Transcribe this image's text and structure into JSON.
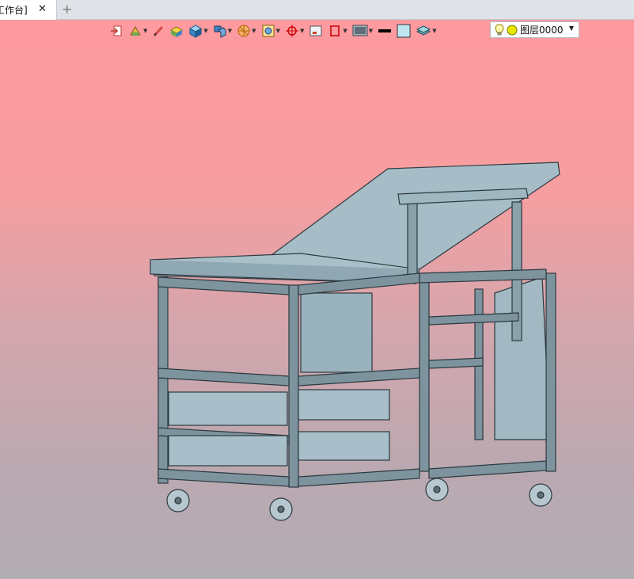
{
  "tabs": [
    {
      "label": "工作台]",
      "active": true
    }
  ],
  "tab_close_symbol": "✕",
  "tab_add_symbol": "+",
  "toolbar": {
    "icons": [
      "exit-sketch-icon",
      "component-icon",
      "pen-icon",
      "extrude-icon",
      "box-icon",
      "view-orient-icon",
      "render-mode-icon",
      "section-view-icon",
      "snap-point-icon",
      "fit-view-icon",
      "dimension-icon",
      "display-mode-icon",
      "line-color-icon",
      "fill-color-icon",
      "layer-manager-icon"
    ],
    "layer_selector": {
      "value": "图层0000"
    }
  },
  "colors": {
    "viewport_top": "#fe9aa0",
    "viewport_bottom": "#b3adb4",
    "model_fill": "#9fb7c1",
    "model_edge": "#2c3a40"
  }
}
